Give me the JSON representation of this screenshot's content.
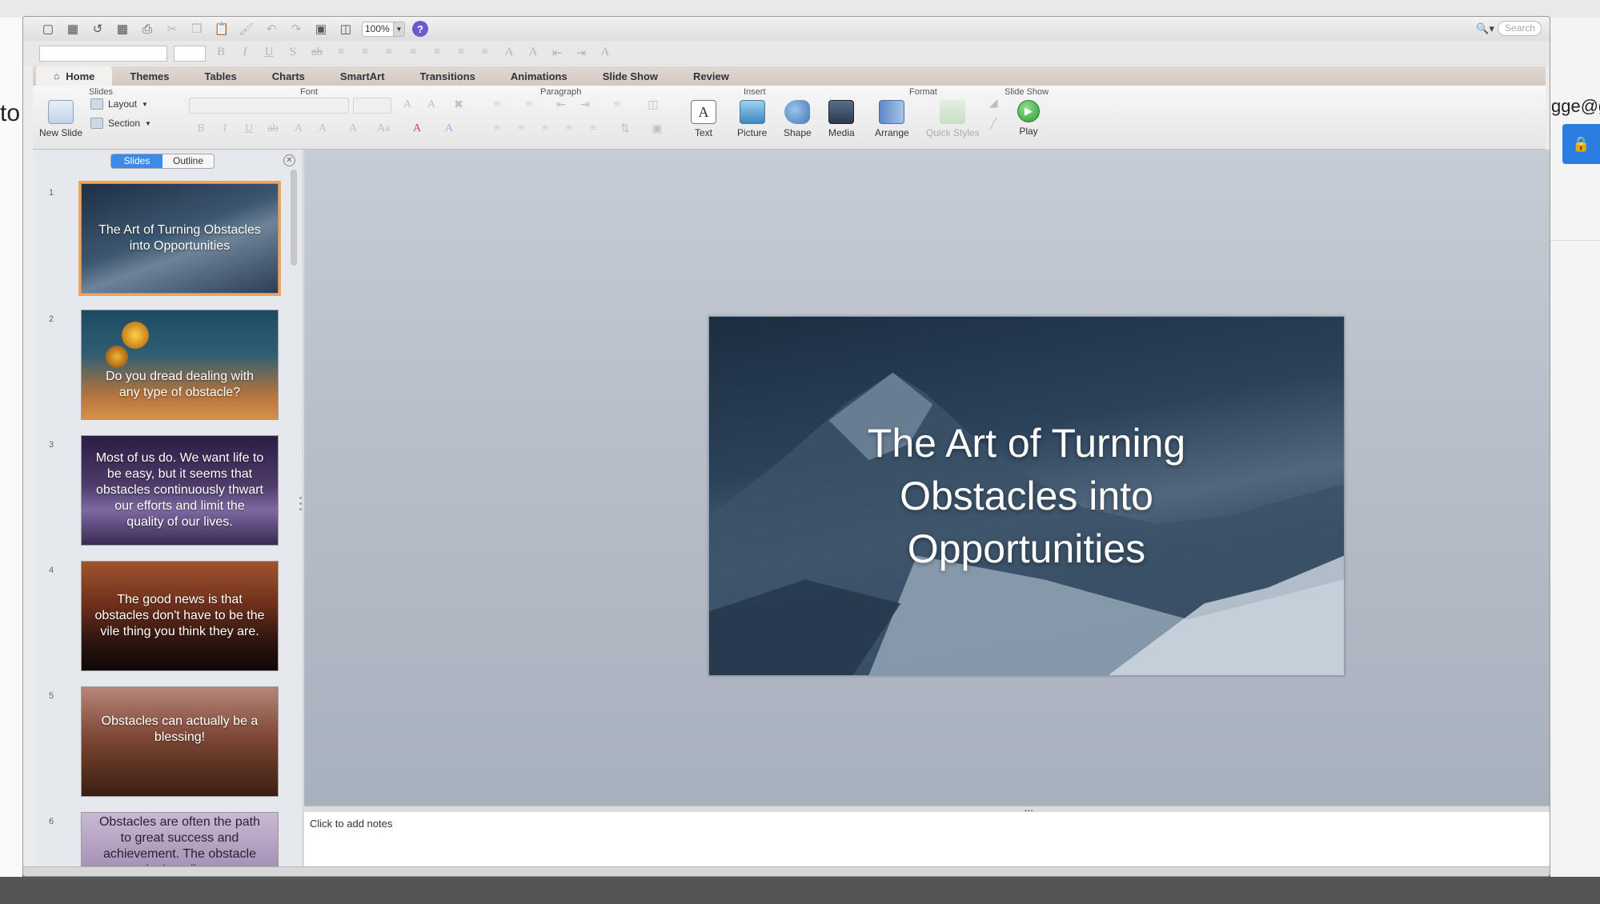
{
  "app": {
    "zoom": "100%",
    "search_placeholder": "Search"
  },
  "tabs": [
    "Home",
    "Themes",
    "Tables",
    "Charts",
    "SmartArt",
    "Transitions",
    "Animations",
    "Slide Show",
    "Review"
  ],
  "ribbon": {
    "groups": {
      "slides": "Slides",
      "font": "Font",
      "paragraph": "Paragraph",
      "insert": "Insert",
      "format": "Format",
      "slideshow": "Slide Show"
    },
    "new_slide": "New Slide",
    "layout": "Layout",
    "section": "Section",
    "text": "Text",
    "picture": "Picture",
    "shape": "Shape",
    "media": "Media",
    "arrange": "Arrange",
    "quick_styles": "Quick Styles",
    "play": "Play"
  },
  "pane": {
    "slides_tab": "Slides",
    "outline_tab": "Outline"
  },
  "slides": [
    {
      "num": "1",
      "text": "The Art of Turning Obstacles into Opportunities"
    },
    {
      "num": "2",
      "text": "Do you dread dealing with any type of obstacle?"
    },
    {
      "num": "3",
      "text": "Most of us do. We want life to be easy, but it seems that obstacles continuously thwart our efforts and limit the quality of our lives."
    },
    {
      "num": "4",
      "text": "The good news is that obstacles don't have to be the vile thing you think they are."
    },
    {
      "num": "5",
      "text": "Obstacles can actually be a blessing!"
    },
    {
      "num": "6",
      "text": "Obstacles are often the path to great success and achievement. The obstacle isn't really a"
    }
  ],
  "main_slide": {
    "title": "The Art of Turning\nObstacles into\nOpportunities"
  },
  "notes_placeholder": "Click to add notes",
  "background": {
    "peek_left": "to",
    "peek_right": "gge@g"
  },
  "colors": {
    "selection": "#f0a458",
    "segment_active": "#3d8be8"
  }
}
